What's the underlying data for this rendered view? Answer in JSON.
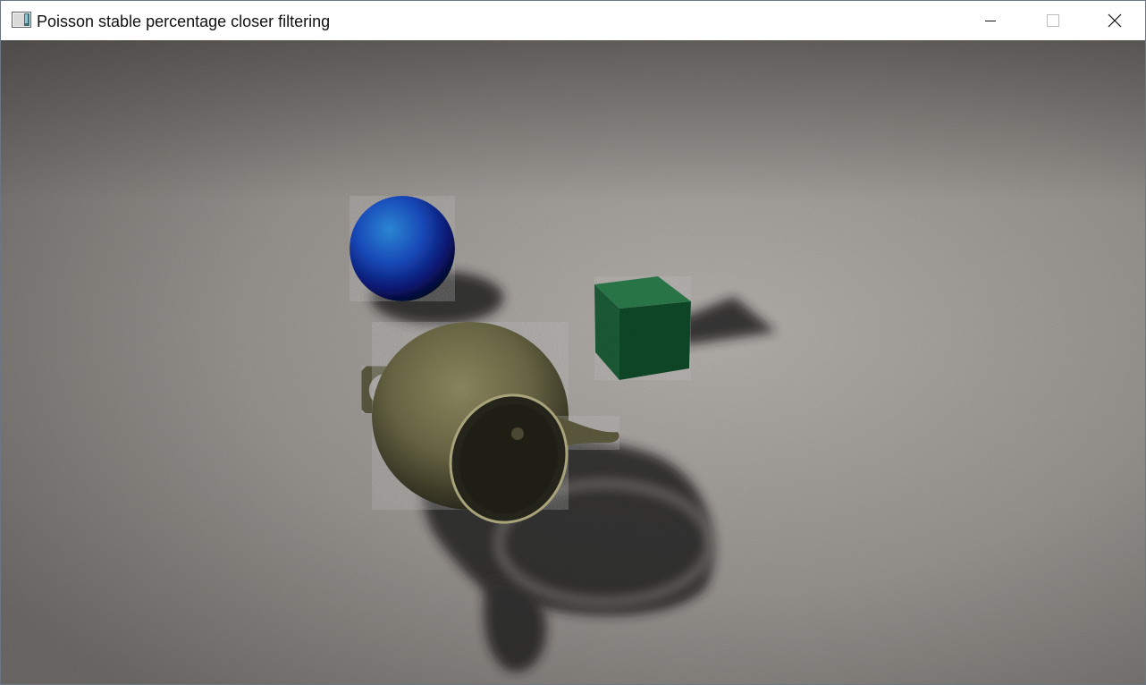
{
  "window": {
    "title": "Poisson stable percentage closer filtering",
    "app_icon": "opengl-window-icon",
    "controls": {
      "minimize_icon": "minimize-icon",
      "maximize_icon": "maximize-icon",
      "close_icon": "close-icon"
    }
  },
  "scene": {
    "objects": [
      {
        "name": "sphere",
        "color": "#1a3fb8"
      },
      {
        "name": "cube",
        "color": "#1f6b3f"
      },
      {
        "name": "teapot",
        "color": "#6d6a47"
      }
    ],
    "floor_color": "#9a9692",
    "shadow_color": "#1e1d1c"
  }
}
